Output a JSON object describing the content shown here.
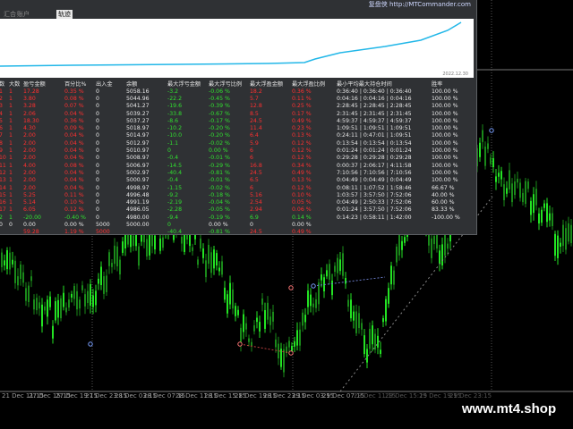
{
  "panel": {
    "tabs": [
      "汇合",
      "账户",
      "轨迹"
    ],
    "brand_name": "复盘侠",
    "brand_url": "http://MTCommander.com",
    "curve_date": "2022.12.30",
    "columns": [
      "数",
      "大数",
      "盈亏金额",
      "百分比%",
      "出入金",
      "余额",
      "最大浮亏金额",
      "最大浮亏比例",
      "最大浮盈金额",
      "最大浮盈比例",
      "最小平均最大持仓时间",
      "胜率"
    ],
    "rows": [
      [
        "1",
        "1",
        "17.28",
        "0.35 %",
        "0",
        "5058.16",
        "-3.2",
        "-0.06 %",
        "18.2",
        "0.36 %",
        "0:36:40 | 0:36:40 | 0:36:40",
        "100.00 %"
      ],
      [
        "2",
        "1",
        "3.80",
        "0.08 %",
        "0",
        "5044.96",
        "-22.2",
        "-0.45 %",
        "5.7",
        "0.11 %",
        "0:04:16 | 0:04:16 | 0:04:16",
        "100.00 %"
      ],
      [
        "3",
        "1",
        "3.28",
        "0.07 %",
        "0",
        "5041.27",
        "-19.6",
        "-0.39 %",
        "12.8",
        "0.25 %",
        "2:28:45 | 2:28:45 | 2:28:45",
        "100.00 %"
      ],
      [
        "4",
        "1",
        "2.06",
        "0.04 %",
        "0",
        "5039.27",
        "-33.8",
        "-0.67 %",
        "8.5",
        "0.17 %",
        "2:31:45 | 2:31:45 | 2:31:45",
        "100.00 %"
      ],
      [
        "5",
        "1",
        "18.30",
        "0.36 %",
        "0",
        "5037.27",
        "-8.6",
        "-0.17 %",
        "24.5",
        "0.49 %",
        "4:59:37 | 4:59:37 | 4:59:37",
        "100.00 %"
      ],
      [
        "6",
        "1",
        "4.30",
        "0.09 %",
        "0",
        "5018.97",
        "-10.2",
        "-0.20 %",
        "11.4",
        "0.23 %",
        "1:09:51 | 1:09:51 | 1:09:51",
        "100.00 %"
      ],
      [
        "7",
        "1",
        "2.00",
        "0.04 %",
        "0",
        "5014.97",
        "-10.0",
        "-0.20 %",
        "6.4",
        "0.13 %",
        "0:24:11 | 0:47:01 | 1:09:51",
        "100.00 %"
      ],
      [
        "8",
        "1",
        "2.00",
        "0.04 %",
        "0",
        "5012.97",
        "-1.1",
        "-0.02 %",
        "5.9",
        "0.12 %",
        "0:13:54 | 0:13:54 | 0:13:54",
        "100.00 %"
      ],
      [
        "9",
        "1",
        "2.00",
        "0.04 %",
        "0",
        "5010.97",
        "0",
        "0.00 %",
        "6",
        "0.12 %",
        "0:01:24 | 0:01:24 | 0:01:24",
        "100.00 %"
      ],
      [
        "10",
        "1",
        "2.00",
        "0.04 %",
        "0",
        "5008.97",
        "-0.4",
        "-0.01 %",
        "6",
        "0.12 %",
        "0:29:28 | 0:29:28 | 0:29:28",
        "100.00 %"
      ],
      [
        "11",
        "1",
        "4.00",
        "0.08 %",
        "0",
        "5006.97",
        "-14.5",
        "-0.29 %",
        "16.8",
        "0.34 %",
        "0:00:37 | 2:06:17 | 4:11:58",
        "100.00 %"
      ],
      [
        "12",
        "1",
        "2.00",
        "0.04 %",
        "0",
        "5002.97",
        "-40.4",
        "-0.81 %",
        "24.5",
        "0.49 %",
        "7:10:56 | 7:10:56 | 7:10:56",
        "100.00 %"
      ],
      [
        "13",
        "1",
        "2.00",
        "0.04 %",
        "0",
        "5000.97",
        "-0.4",
        "-0.01 %",
        "6.5",
        "0.13 %",
        "0:04:49 | 0:04:49 | 0:04:49",
        "100.00 %"
      ],
      [
        "14",
        "1",
        "2.00",
        "0.04 %",
        "0",
        "4998.97",
        "-1.15",
        "-0.02 %",
        "6",
        "0.12 %",
        "0:08:11 | 1:07:52 | 1:58:46",
        "66.67 %"
      ],
      [
        "15",
        "1",
        "5.25",
        "0.11 %",
        "0",
        "4996.48",
        "-9.2",
        "-0.18 %",
        "5.16",
        "0.10 %",
        "1:03:57 | 3:57:50 | 7:52:06",
        "40.00 %"
      ],
      [
        "16",
        "1",
        "5.14",
        "0.10 %",
        "0",
        "4991.19",
        "-2.19",
        "-0.04 %",
        "2.54",
        "0.05 %",
        "0:04:49 | 2:50:33 | 7:52:06",
        "60.00 %"
      ],
      [
        "17",
        "1",
        "6.05",
        "0.12 %",
        "0",
        "4986.05",
        "-2.28",
        "-0.05 %",
        "2.94",
        "0.06 %",
        "0:01:24 | 3:57:50 | 7:52:06",
        "83.33 %"
      ],
      [
        "2",
        "1",
        "-20.00",
        "-0.40 %",
        "0",
        "4980.00",
        "-9.4",
        "-0.19 %",
        "6.9",
        "0.14 %",
        "0:14:23 | 0:58:11 | 1:42:00",
        "-100.00 %"
      ],
      [
        "0",
        "0",
        "0.00",
        "0.00 %",
        "5000",
        "5000.00",
        "0",
        "0.00 %",
        "0",
        "0.00 %",
        "",
        ""
      ],
      [
        "",
        "",
        "59.28",
        "1.19 %",
        "5000",
        "",
        "-40.4",
        "-0.81 %",
        "24.5",
        "0.49 %",
        "",
        ""
      ]
    ],
    "row_colors": [
      "red",
      "red",
      "red",
      "red",
      "red",
      "red",
      "red",
      "red",
      "red",
      "red",
      "red",
      "red",
      "red",
      "red",
      "red",
      "red",
      "red",
      "green",
      "white",
      "red"
    ]
  },
  "time_axis": [
    {
      "label": "21 Dec 11:15",
      "dim": false
    },
    {
      "label": "27 Dec 15:15",
      "dim": false
    },
    {
      "label": "27 Dec 19:15",
      "dim": false
    },
    {
      "label": "27 Dec 23:15",
      "dim": false
    },
    {
      "label": "28 Dec 03:15",
      "dim": false
    },
    {
      "label": "28 Dec 07:15",
      "dim": false
    },
    {
      "label": "28 Dec 11:15",
      "dim": false
    },
    {
      "label": "28 Dec 15:15",
      "dim": false
    },
    {
      "label": "28 Dec 19:15",
      "dim": false
    },
    {
      "label": "28 Dec 23:15",
      "dim": false
    },
    {
      "label": "29 Dec 03:15",
      "dim": false
    },
    {
      "label": "29 Dec 07:15",
      "dim": false
    },
    {
      "label": "29 Dec 11:15",
      "dim": true
    },
    {
      "label": "29 Dec 15:15",
      "dim": true
    },
    {
      "label": "29 Dec 19:15",
      "dim": true
    },
    {
      "label": "29 Dec 23:15",
      "dim": true
    }
  ],
  "watermark": "www.mt4.shop",
  "colors": {
    "bull": "#23e323",
    "bear": "#1a8a1a",
    "grid": "#3a3a3a",
    "equity": "#22b7e8"
  }
}
